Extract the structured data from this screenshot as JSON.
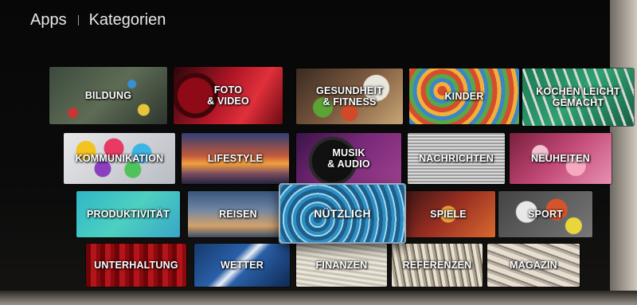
{
  "header": {
    "section": "Apps",
    "page_title": "Kategorien"
  },
  "categories": [
    {
      "label": "BILDUNG"
    },
    {
      "label": "FOTO\n& VIDEO"
    },
    {
      "label": "GESUNDHEIT\n& FITNESS"
    },
    {
      "label": "KINDER"
    },
    {
      "label": "KOCHEN LEICHT\nGEMACHT"
    },
    {
      "label": "KOMMUNIKATION"
    },
    {
      "label": "LIFESTYLE"
    },
    {
      "label": "MUSIK\n& AUDIO"
    },
    {
      "label": "NACHRICHTEN"
    },
    {
      "label": "NEUHEITEN"
    },
    {
      "label": "PRODUKTIVITÄT"
    },
    {
      "label": "REISEN"
    },
    {
      "label": "NÜTZLICH",
      "focused": true
    },
    {
      "label": "SPIELE"
    },
    {
      "label": "SPORT"
    },
    {
      "label": "UNTERHALTUNG"
    },
    {
      "label": "WETTER"
    },
    {
      "label": "FINANZEN"
    },
    {
      "label": "REFERENZEN"
    },
    {
      "label": "MAGAZIN"
    }
  ]
}
